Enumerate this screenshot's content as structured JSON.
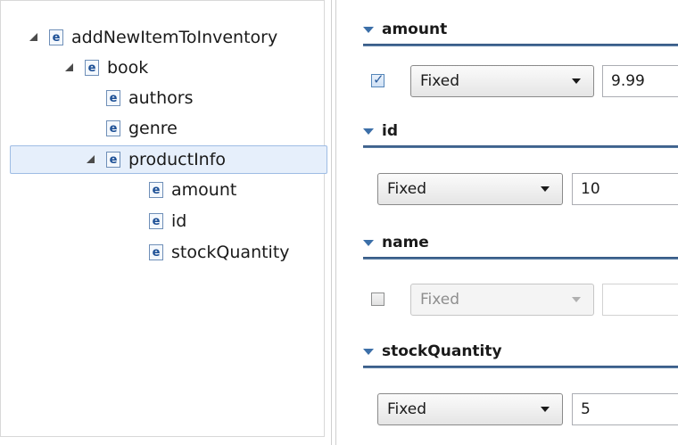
{
  "tree": {
    "nodes": [
      {
        "label": "addNewItemToInventory",
        "expanded": true
      },
      {
        "label": "book",
        "expanded": true
      },
      {
        "label": "authors"
      },
      {
        "label": "genre"
      },
      {
        "label": "productInfo",
        "expanded": true,
        "selected": true
      },
      {
        "label": "amount"
      },
      {
        "label": "id"
      },
      {
        "label": "stockQuantity"
      }
    ]
  },
  "form": {
    "sections": [
      {
        "title": "amount",
        "checkbox": "checked",
        "mode": "Fixed",
        "value": "9.99"
      },
      {
        "title": "id",
        "mode": "Fixed",
        "value": "10"
      },
      {
        "title": "name",
        "checkbox": "unchecked",
        "mode": "Fixed",
        "value": "",
        "disabled": true
      },
      {
        "title": "stockQuantity",
        "mode": "Fixed",
        "value": "5"
      }
    ]
  },
  "colors": {
    "selection_bg": "#e6effb",
    "selection_border": "#9ebce4",
    "section_line": "#2c4f7c",
    "icon_border": "#6f8fb8",
    "icon_text": "#1c4f95"
  },
  "icons": {
    "element": "e",
    "expanded_toggle": "expanded-triangle-icon",
    "section_caret": "caret-down-icon",
    "dropdown_arrow": "chevron-down-icon"
  }
}
